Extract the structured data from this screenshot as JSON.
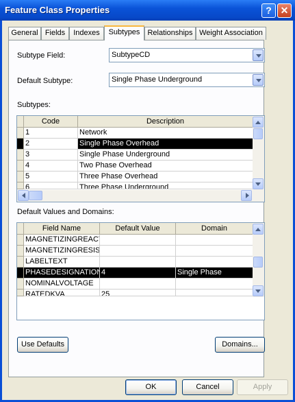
{
  "window": {
    "title": "Feature Class Properties",
    "help_glyph": "?",
    "close_glyph": "✕"
  },
  "tabs": [
    {
      "label": "General"
    },
    {
      "label": "Fields"
    },
    {
      "label": "Indexes"
    },
    {
      "label": "Subtypes"
    },
    {
      "label": "Relationships"
    },
    {
      "label": "Weight Association"
    }
  ],
  "active_tab": "Subtypes",
  "subtype_field": {
    "label": "Subtype Field:",
    "value": "SubtypeCD"
  },
  "default_subtype": {
    "label": "Default Subtype:",
    "value": "Single Phase Underground"
  },
  "subtypes": {
    "label": "Subtypes:",
    "columns": [
      "Code",
      "Description"
    ],
    "rows": [
      {
        "code": "1",
        "description": "Network"
      },
      {
        "code": "2",
        "description": "Single Phase Overhead"
      },
      {
        "code": "3",
        "description": "Single Phase Underground"
      },
      {
        "code": "4",
        "description": "Two Phase Overhead"
      },
      {
        "code": "5",
        "description": "Three Phase Overhead"
      },
      {
        "code": "6",
        "description": "Three Phase Underground"
      }
    ],
    "selected_code": "2"
  },
  "defaults": {
    "label": "Default Values and Domains:",
    "columns": [
      "Field Name",
      "Default Value",
      "Domain"
    ],
    "rows": [
      {
        "field": "MAGNETIZINGREACT",
        "default": "",
        "domain": ""
      },
      {
        "field": "MAGNETIZINGRESIST",
        "default": "",
        "domain": ""
      },
      {
        "field": "LABELTEXT",
        "default": "",
        "domain": ""
      },
      {
        "field": "PHASEDESIGNATION",
        "default": "4",
        "domain": "Single Phase"
      },
      {
        "field": "NOMINALVOLTAGE",
        "default": "",
        "domain": ""
      },
      {
        "field": "RATEDKVA",
        "default": "25",
        "domain": ""
      }
    ],
    "selected_field": "PHASEDESIGNATION"
  },
  "buttons": {
    "use_defaults": "Use Defaults",
    "domains": "Domains...",
    "ok": "OK",
    "cancel": "Cancel",
    "apply": "Apply"
  }
}
